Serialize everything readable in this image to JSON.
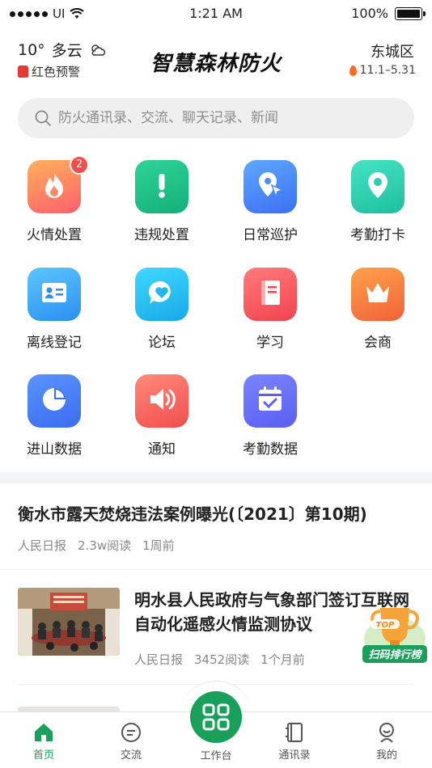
{
  "status_bar": {
    "carrier": "UI",
    "time": "1:21 AM",
    "battery": "100%",
    "battery_level": 1.0
  },
  "header": {
    "temperature": "10°",
    "weather": "多云",
    "warning": "红色预警",
    "title": "智慧森林防火",
    "district": "东城区",
    "fire_season": "11.1–5.31"
  },
  "search": {
    "placeholder": "防火通讯录、交流、聊天记录、新闻"
  },
  "grid": [
    {
      "label": "火情处置",
      "icon": "fire-icon",
      "badge": "2",
      "colors": [
        "#ffb15a",
        "#ff5f6d"
      ]
    },
    {
      "label": "违规处置",
      "icon": "exclamation-icon",
      "colors": [
        "#30d39a",
        "#13b07a"
      ]
    },
    {
      "label": "日常巡护",
      "icon": "location-arrow-icon",
      "colors": [
        "#5ea8ff",
        "#3c6ff2"
      ]
    },
    {
      "label": "考勤打卡",
      "icon": "map-pin-icon",
      "colors": [
        "#46e3c6",
        "#1dbf9e"
      ]
    },
    {
      "label": "离线登记",
      "icon": "id-card-icon",
      "colors": [
        "#5cc6ff",
        "#2b90f0"
      ]
    },
    {
      "label": "论坛",
      "icon": "chat-heart-icon",
      "colors": [
        "#3fd9ff",
        "#18a9e8"
      ]
    },
    {
      "label": "学习",
      "icon": "book-icon",
      "colors": [
        "#ff7b7b",
        "#f2434f"
      ]
    },
    {
      "label": "会商",
      "icon": "crown-icon",
      "colors": [
        "#ffa24a",
        "#f2623a"
      ]
    },
    {
      "label": "进山数据",
      "icon": "pie-chart-icon",
      "colors": [
        "#5b93ff",
        "#3a6df0"
      ]
    },
    {
      "label": "通知",
      "icon": "speaker-icon",
      "colors": [
        "#ff8a7a",
        "#f24e4e"
      ]
    },
    {
      "label": "考勤数据",
      "icon": "calendar-check-icon",
      "colors": [
        "#7b83ff",
        "#5a5ff0"
      ]
    }
  ],
  "news": [
    {
      "title": "衡水市露天焚烧违法案例曝光(〔2021〕第10期)",
      "source": "人民日报",
      "reads": "2.3w阅读",
      "time": "1周前"
    },
    {
      "title": "明水县人民政府与气象部门签订互联网自动化遥感火情监测协议",
      "source": "人民日报",
      "reads": "3452阅读",
      "time": "1个月前"
    }
  ],
  "floating": {
    "top": "TOP",
    "label": "扫码排行榜"
  },
  "tabbar": {
    "home": "首页",
    "chat": "交流",
    "workbench": "工作台",
    "contacts": "通讯录",
    "mine": "我的"
  },
  "colors": {
    "accent": "#1aa05b",
    "warning": "#e53935"
  }
}
